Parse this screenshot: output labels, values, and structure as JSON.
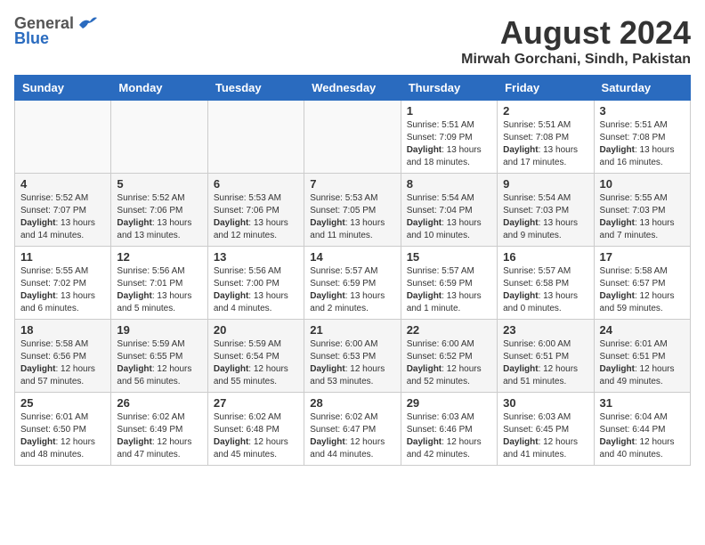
{
  "header": {
    "logo_general": "General",
    "logo_blue": "Blue",
    "month": "August 2024",
    "location": "Mirwah Gorchani, Sindh, Pakistan"
  },
  "weekdays": [
    "Sunday",
    "Monday",
    "Tuesday",
    "Wednesday",
    "Thursday",
    "Friday",
    "Saturday"
  ],
  "weeks": [
    [
      {
        "day": "",
        "info": ""
      },
      {
        "day": "",
        "info": ""
      },
      {
        "day": "",
        "info": ""
      },
      {
        "day": "",
        "info": ""
      },
      {
        "day": "1",
        "sunrise": "Sunrise: 5:51 AM",
        "sunset": "Sunset: 7:09 PM",
        "daylight": "Daylight: 13 hours and 18 minutes."
      },
      {
        "day": "2",
        "sunrise": "Sunrise: 5:51 AM",
        "sunset": "Sunset: 7:08 PM",
        "daylight": "Daylight: 13 hours and 17 minutes."
      },
      {
        "day": "3",
        "sunrise": "Sunrise: 5:51 AM",
        "sunset": "Sunset: 7:08 PM",
        "daylight": "Daylight: 13 hours and 16 minutes."
      }
    ],
    [
      {
        "day": "4",
        "sunrise": "Sunrise: 5:52 AM",
        "sunset": "Sunset: 7:07 PM",
        "daylight": "Daylight: 13 hours and 14 minutes."
      },
      {
        "day": "5",
        "sunrise": "Sunrise: 5:52 AM",
        "sunset": "Sunset: 7:06 PM",
        "daylight": "Daylight: 13 hours and 13 minutes."
      },
      {
        "day": "6",
        "sunrise": "Sunrise: 5:53 AM",
        "sunset": "Sunset: 7:06 PM",
        "daylight": "Daylight: 13 hours and 12 minutes."
      },
      {
        "day": "7",
        "sunrise": "Sunrise: 5:53 AM",
        "sunset": "Sunset: 7:05 PM",
        "daylight": "Daylight: 13 hours and 11 minutes."
      },
      {
        "day": "8",
        "sunrise": "Sunrise: 5:54 AM",
        "sunset": "Sunset: 7:04 PM",
        "daylight": "Daylight: 13 hours and 10 minutes."
      },
      {
        "day": "9",
        "sunrise": "Sunrise: 5:54 AM",
        "sunset": "Sunset: 7:03 PM",
        "daylight": "Daylight: 13 hours and 9 minutes."
      },
      {
        "day": "10",
        "sunrise": "Sunrise: 5:55 AM",
        "sunset": "Sunset: 7:03 PM",
        "daylight": "Daylight: 13 hours and 7 minutes."
      }
    ],
    [
      {
        "day": "11",
        "sunrise": "Sunrise: 5:55 AM",
        "sunset": "Sunset: 7:02 PM",
        "daylight": "Daylight: 13 hours and 6 minutes."
      },
      {
        "day": "12",
        "sunrise": "Sunrise: 5:56 AM",
        "sunset": "Sunset: 7:01 PM",
        "daylight": "Daylight: 13 hours and 5 minutes."
      },
      {
        "day": "13",
        "sunrise": "Sunrise: 5:56 AM",
        "sunset": "Sunset: 7:00 PM",
        "daylight": "Daylight: 13 hours and 4 minutes."
      },
      {
        "day": "14",
        "sunrise": "Sunrise: 5:57 AM",
        "sunset": "Sunset: 6:59 PM",
        "daylight": "Daylight: 13 hours and 2 minutes."
      },
      {
        "day": "15",
        "sunrise": "Sunrise: 5:57 AM",
        "sunset": "Sunset: 6:59 PM",
        "daylight": "Daylight: 13 hours and 1 minute."
      },
      {
        "day": "16",
        "sunrise": "Sunrise: 5:57 AM",
        "sunset": "Sunset: 6:58 PM",
        "daylight": "Daylight: 13 hours and 0 minutes."
      },
      {
        "day": "17",
        "sunrise": "Sunrise: 5:58 AM",
        "sunset": "Sunset: 6:57 PM",
        "daylight": "Daylight: 12 hours and 59 minutes."
      }
    ],
    [
      {
        "day": "18",
        "sunrise": "Sunrise: 5:58 AM",
        "sunset": "Sunset: 6:56 PM",
        "daylight": "Daylight: 12 hours and 57 minutes."
      },
      {
        "day": "19",
        "sunrise": "Sunrise: 5:59 AM",
        "sunset": "Sunset: 6:55 PM",
        "daylight": "Daylight: 12 hours and 56 minutes."
      },
      {
        "day": "20",
        "sunrise": "Sunrise: 5:59 AM",
        "sunset": "Sunset: 6:54 PM",
        "daylight": "Daylight: 12 hours and 55 minutes."
      },
      {
        "day": "21",
        "sunrise": "Sunrise: 6:00 AM",
        "sunset": "Sunset: 6:53 PM",
        "daylight": "Daylight: 12 hours and 53 minutes."
      },
      {
        "day": "22",
        "sunrise": "Sunrise: 6:00 AM",
        "sunset": "Sunset: 6:52 PM",
        "daylight": "Daylight: 12 hours and 52 minutes."
      },
      {
        "day": "23",
        "sunrise": "Sunrise: 6:00 AM",
        "sunset": "Sunset: 6:51 PM",
        "daylight": "Daylight: 12 hours and 51 minutes."
      },
      {
        "day": "24",
        "sunrise": "Sunrise: 6:01 AM",
        "sunset": "Sunset: 6:51 PM",
        "daylight": "Daylight: 12 hours and 49 minutes."
      }
    ],
    [
      {
        "day": "25",
        "sunrise": "Sunrise: 6:01 AM",
        "sunset": "Sunset: 6:50 PM",
        "daylight": "Daylight: 12 hours and 48 minutes."
      },
      {
        "day": "26",
        "sunrise": "Sunrise: 6:02 AM",
        "sunset": "Sunset: 6:49 PM",
        "daylight": "Daylight: 12 hours and 47 minutes."
      },
      {
        "day": "27",
        "sunrise": "Sunrise: 6:02 AM",
        "sunset": "Sunset: 6:48 PM",
        "daylight": "Daylight: 12 hours and 45 minutes."
      },
      {
        "day": "28",
        "sunrise": "Sunrise: 6:02 AM",
        "sunset": "Sunset: 6:47 PM",
        "daylight": "Daylight: 12 hours and 44 minutes."
      },
      {
        "day": "29",
        "sunrise": "Sunrise: 6:03 AM",
        "sunset": "Sunset: 6:46 PM",
        "daylight": "Daylight: 12 hours and 42 minutes."
      },
      {
        "day": "30",
        "sunrise": "Sunrise: 6:03 AM",
        "sunset": "Sunset: 6:45 PM",
        "daylight": "Daylight: 12 hours and 41 minutes."
      },
      {
        "day": "31",
        "sunrise": "Sunrise: 6:04 AM",
        "sunset": "Sunset: 6:44 PM",
        "daylight": "Daylight: 12 hours and 40 minutes."
      }
    ]
  ]
}
